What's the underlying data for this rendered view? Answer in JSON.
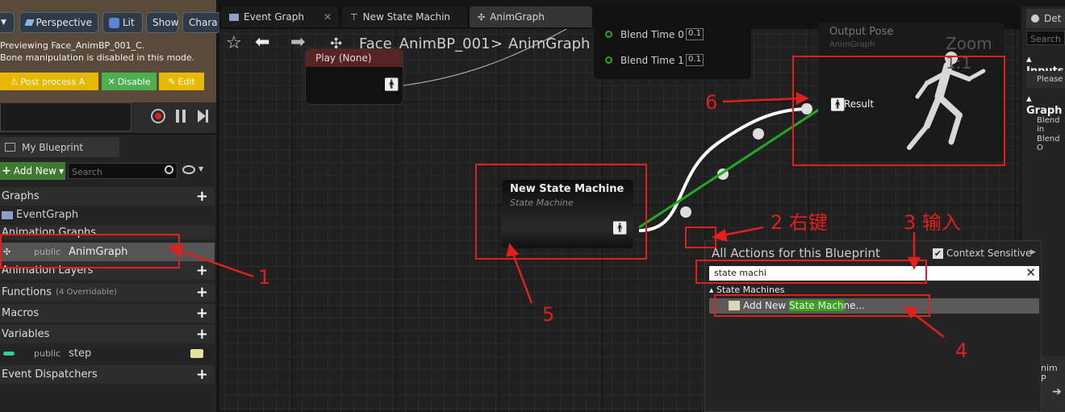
{
  "viewport": {
    "dropdown_glyph": "▼",
    "perspective_label": "Perspective",
    "lit_label": "Lit",
    "show_label": "Show",
    "character_label": "Chara",
    "preview_text": "Previewing Face_AnimBP_001_C.",
    "bone_text": "Bone manipulation is disabled in this mode.",
    "postprocess_label": "Post process A",
    "disable_label": "Disable",
    "edit_label": "Edit"
  },
  "my_blueprint": {
    "tab_label": "My Blueprint",
    "add_new_label": "Add New",
    "search_placeholder": "Search",
    "graphs_label": "Graphs",
    "event_graph_label": "EventGraph",
    "animation_graphs_label": "Animation Graphs",
    "anim_access": "public",
    "anim_graph_label": "AnimGraph",
    "animation_layers_label": "Animation Layers",
    "functions_label": "Functions",
    "functions_count": "(4 Overridable)",
    "macros_label": "Macros",
    "variables_label": "Variables",
    "var_access": "public",
    "var_name": "step",
    "event_dispatchers_label": "Event Dispatchers"
  },
  "tabs": {
    "event_graph": "Event Graph",
    "state_machine": "New State Machin",
    "anim_graph": "AnimGraph"
  },
  "breadcrumb": {
    "blueprint": "Face_AnimBP_001",
    "separator": ">",
    "graph": "AnimGraph"
  },
  "graph": {
    "play_node_title": "Play (None)",
    "blend_time_0": "Blend Time 0",
    "blend_time_1": "Blend Time 1",
    "blend_value_0": "0.1",
    "blend_value_1": "0.1",
    "output_pose_title": "Output Pose",
    "output_pose_subtitle": "AnimGraph",
    "zoom_label": "Zoom 1:1",
    "result_label": "Result",
    "state_machine_title": "New State Machine",
    "state_machine_subtitle": "State Machine"
  },
  "context_menu": {
    "title": "All Actions for this Blueprint",
    "context_sensitive_label": "Context Sensitive",
    "search_value": "state machi",
    "category_label": "State Machines",
    "item_prefix": "Add New ",
    "item_highlight": "State Mach",
    "item_suffix": "ne..."
  },
  "right_panel": {
    "details_label": "Det",
    "search_placeholder": "Search",
    "inputs_label": "Inputs",
    "please_label": "Please",
    "graph_label": "Graph",
    "blend_in_label": "Blend in",
    "blend_out_label": "Blend O",
    "anim_label": "nim P"
  },
  "annotations": {
    "a1": "1",
    "a2": "2 右键",
    "a3": "3 输入",
    "a4": "4",
    "a5": "5",
    "a6": "6"
  },
  "colors": {
    "annotation_red": "#e0201c",
    "annotation_green": "#1faa1f",
    "search_highlight": "#3aa21c",
    "postprocess_yellow": "#e6b800",
    "disable_green": "#4caf50"
  }
}
